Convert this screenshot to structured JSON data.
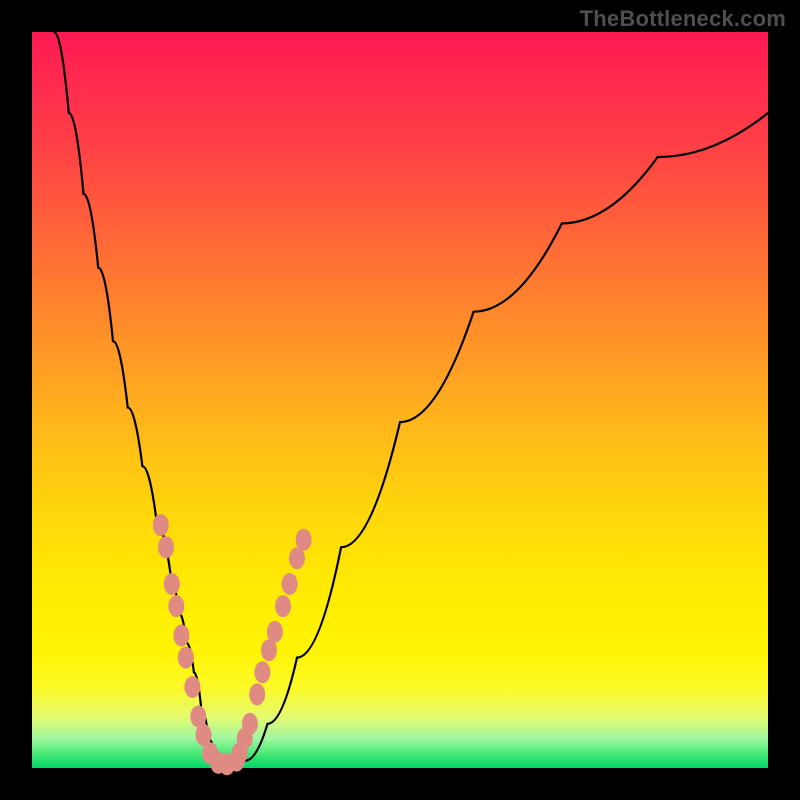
{
  "watermark": "TheBottleneck.com",
  "chart_data": {
    "type": "line",
    "title": "",
    "xlabel": "",
    "ylabel": "",
    "xlim": [
      0,
      100
    ],
    "ylim": [
      0,
      100
    ],
    "grid": false,
    "series": [
      {
        "name": "bottleneck-curve",
        "x": [
          3,
          5,
          7,
          9,
          11,
          13,
          15,
          17,
          19,
          20,
          21,
          22,
          23,
          24,
          25,
          27,
          29,
          32,
          36,
          42,
          50,
          60,
          72,
          85,
          100
        ],
        "values": [
          100,
          89,
          78,
          68,
          58,
          49,
          41,
          33,
          25,
          21,
          17,
          13,
          8,
          4,
          1,
          0.5,
          1,
          6,
          15,
          30,
          47,
          62,
          74,
          83,
          89
        ]
      }
    ],
    "markers": {
      "name": "highlight-dots",
      "color": "#e08a84",
      "points": [
        {
          "x": 17.5,
          "y": 33
        },
        {
          "x": 18.2,
          "y": 30
        },
        {
          "x": 19.0,
          "y": 25
        },
        {
          "x": 19.6,
          "y": 22
        },
        {
          "x": 20.3,
          "y": 18
        },
        {
          "x": 20.9,
          "y": 15
        },
        {
          "x": 21.8,
          "y": 11
        },
        {
          "x": 22.6,
          "y": 7
        },
        {
          "x": 23.3,
          "y": 4.5
        },
        {
          "x": 24.2,
          "y": 2
        },
        {
          "x": 25.3,
          "y": 0.7
        },
        {
          "x": 26.5,
          "y": 0.5
        },
        {
          "x": 27.8,
          "y": 1
        },
        {
          "x": 28.2,
          "y": 2
        },
        {
          "x": 28.9,
          "y": 4
        },
        {
          "x": 29.6,
          "y": 6
        },
        {
          "x": 30.6,
          "y": 10
        },
        {
          "x": 31.3,
          "y": 13
        },
        {
          "x": 32.2,
          "y": 16
        },
        {
          "x": 33.0,
          "y": 18.5
        },
        {
          "x": 34.1,
          "y": 22
        },
        {
          "x": 35.0,
          "y": 25
        },
        {
          "x": 36.0,
          "y": 28.5
        },
        {
          "x": 36.9,
          "y": 31
        }
      ]
    }
  }
}
